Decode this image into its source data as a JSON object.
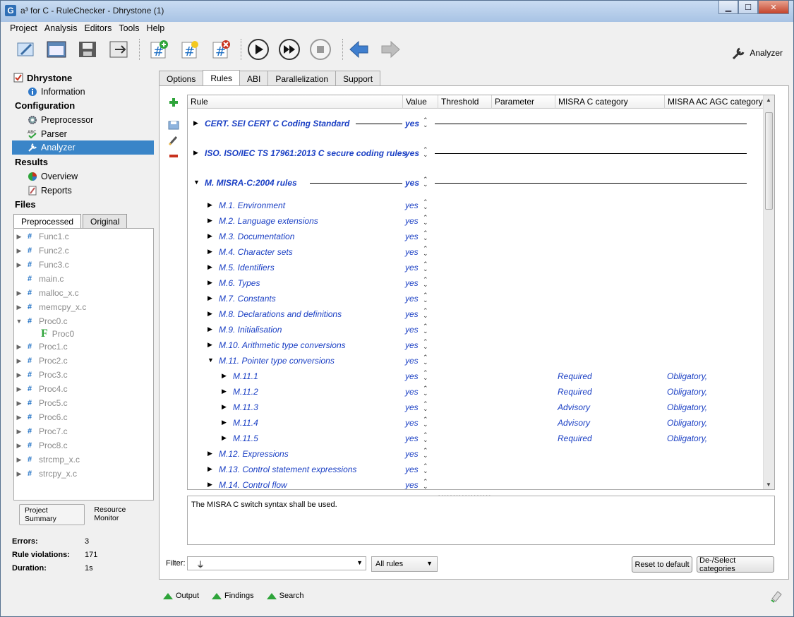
{
  "window": {
    "title": "a³ for C - RuleChecker - Dhrystone (1)",
    "logo": "G"
  },
  "menu": [
    "Project",
    "Analysis",
    "Editors",
    "Tools",
    "Help"
  ],
  "toolbar": {
    "analyzer_label": "Analyzer"
  },
  "nav": {
    "project": "Dhrystone",
    "information": "Information",
    "configuration": "Configuration",
    "preprocessor": "Preprocessor",
    "parser": "Parser",
    "analyzer": "Analyzer",
    "results": "Results",
    "overview": "Overview",
    "reports": "Reports",
    "files": "Files"
  },
  "file_tabs": [
    "Preprocessed",
    "Original"
  ],
  "files": [
    {
      "name": "Func1.c",
      "icon": "#"
    },
    {
      "name": "Func2.c",
      "icon": "#"
    },
    {
      "name": "Func3.c",
      "icon": "#"
    },
    {
      "name": "main.c",
      "icon": "#"
    },
    {
      "name": "malloc_x.c",
      "icon": "#"
    },
    {
      "name": "memcpy_x.c",
      "icon": "#"
    },
    {
      "name": "Proc0.c",
      "icon": "#"
    },
    {
      "name": "Proc0",
      "icon": "F"
    },
    {
      "name": "Proc1.c",
      "icon": "#"
    },
    {
      "name": "Proc2.c",
      "icon": "#"
    },
    {
      "name": "Proc3.c",
      "icon": "#"
    },
    {
      "name": "Proc4.c",
      "icon": "#"
    },
    {
      "name": "Proc5.c",
      "icon": "#"
    },
    {
      "name": "Proc6.c",
      "icon": "#"
    },
    {
      "name": "Proc7.c",
      "icon": "#"
    },
    {
      "name": "Proc8.c",
      "icon": "#"
    },
    {
      "name": "strcmp_x.c",
      "icon": "#"
    },
    {
      "name": "strcpy_x.c",
      "icon": "#"
    }
  ],
  "bottom_tabs": [
    "Project Summary",
    "Resource Monitor"
  ],
  "stats": {
    "errors_label": "Errors:",
    "errors": "3",
    "violations_label": "Rule violations:",
    "violations": "171",
    "duration_label": "Duration:",
    "duration": "1s"
  },
  "tabs": [
    "Options",
    "Rules",
    "ABI",
    "Parallelization",
    "Support"
  ],
  "grid": {
    "headers": [
      "Rule",
      "Value",
      "Threshold",
      "Parameter",
      "MISRA C category",
      "MISRA AC AGC category"
    ],
    "rows": [
      {
        "label": "CERT. SEI CERT C Coding Standard",
        "value": "yes",
        "misra": "",
        "agc": ""
      },
      {
        "label": "ISO. ISO/IEC TS 17961:2013 C secure coding rules",
        "value": "yes",
        "misra": "",
        "agc": ""
      },
      {
        "label": "M. MISRA-C:2004 rules",
        "value": "yes",
        "misra": "",
        "agc": ""
      },
      {
        "label": "M.1. Environment",
        "value": "yes",
        "misra": "",
        "agc": ""
      },
      {
        "label": "M.2. Language extensions",
        "value": "yes",
        "misra": "",
        "agc": ""
      },
      {
        "label": "M.3. Documentation",
        "value": "yes",
        "misra": "",
        "agc": ""
      },
      {
        "label": "M.4. Character sets",
        "value": "yes",
        "misra": "",
        "agc": ""
      },
      {
        "label": "M.5. Identifiers",
        "value": "yes",
        "misra": "",
        "agc": ""
      },
      {
        "label": "M.6. Types",
        "value": "yes",
        "misra": "",
        "agc": ""
      },
      {
        "label": "M.7. Constants",
        "value": "yes",
        "misra": "",
        "agc": ""
      },
      {
        "label": "M.8. Declarations and definitions",
        "value": "yes",
        "misra": "",
        "agc": ""
      },
      {
        "label": "M.9. Initialisation",
        "value": "yes",
        "misra": "",
        "agc": ""
      },
      {
        "label": "M.10. Arithmetic type conversions",
        "value": "yes",
        "misra": "",
        "agc": ""
      },
      {
        "label": "M.11. Pointer type conversions",
        "value": "yes",
        "misra": "",
        "agc": ""
      },
      {
        "label": "M.11.1",
        "value": "yes",
        "misra": "Required",
        "agc": "Obligatory,"
      },
      {
        "label": "M.11.2",
        "value": "yes",
        "misra": "Required",
        "agc": "Obligatory,"
      },
      {
        "label": "M.11.3",
        "value": "yes",
        "misra": "Advisory",
        "agc": "Obligatory,"
      },
      {
        "label": "M.11.4",
        "value": "yes",
        "misra": "Advisory",
        "agc": "Obligatory,"
      },
      {
        "label": "M.11.5",
        "value": "yes",
        "misra": "Required",
        "agc": "Obligatory,"
      },
      {
        "label": "M.12. Expressions",
        "value": "yes",
        "misra": "",
        "agc": ""
      },
      {
        "label": "M.13. Control statement expressions",
        "value": "yes",
        "misra": "",
        "agc": ""
      },
      {
        "label": "M.14. Control flow",
        "value": "yes",
        "misra": "",
        "agc": ""
      }
    ]
  },
  "description": "The MISRA C switch syntax shall be used.",
  "filter": {
    "label": "Filter:",
    "value": "",
    "combo": "All rules"
  },
  "buttons": {
    "reset": "Reset to default",
    "deselect": "De-/Select categories"
  },
  "outputs": [
    "Output",
    "Findings",
    "Search"
  ]
}
